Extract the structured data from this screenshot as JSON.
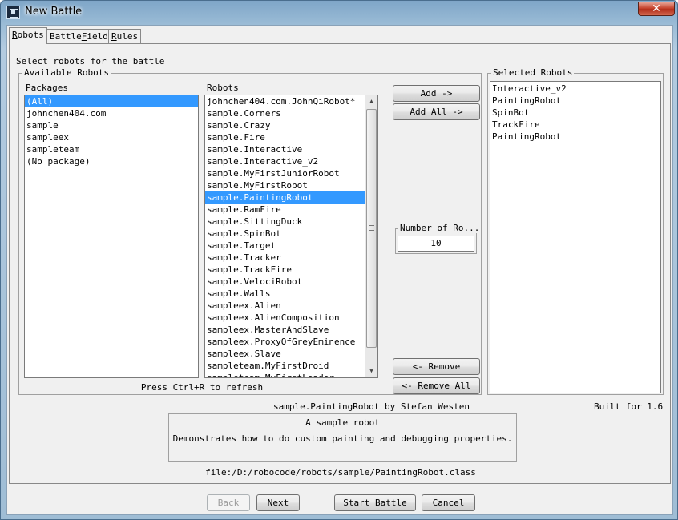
{
  "window": {
    "title": "New Battle",
    "close_label": "✕"
  },
  "tabs": [
    {
      "label": "Robots",
      "mnemonic": "R",
      "rest": "obots"
    },
    {
      "label": "BattleField",
      "pre": "Battle",
      "mnemonic": "F",
      "rest": "ield"
    },
    {
      "label": "Rules",
      "mnemonic": "R",
      "rest": "ules"
    }
  ],
  "robots_tab": {
    "instruction": "Select robots for the battle",
    "available_group": "Available Robots",
    "packages_header": "Packages",
    "robots_header": "Robots",
    "packages": [
      "(All)",
      "johnchen404.com",
      "sample",
      "sampleex",
      "sampleteam",
      "(No package)"
    ],
    "packages_selected": "(All)",
    "robots": [
      "johnchen404.com.JohnQiRobot*",
      "sample.Corners",
      "sample.Crazy",
      "sample.Fire",
      "sample.Interactive",
      "sample.Interactive_v2",
      "sample.MyFirstJuniorRobot",
      "sample.MyFirstRobot",
      "sample.PaintingRobot",
      "sample.RamFire",
      "sample.SittingDuck",
      "sample.SpinBot",
      "sample.Target",
      "sample.Tracker",
      "sample.TrackFire",
      "sample.VelociRobot",
      "sample.Walls",
      "sampleex.Alien",
      "sampleex.AlienComposition",
      "sampleex.MasterAndSlave",
      "sampleex.ProxyOfGreyEminence",
      "sampleex.Slave",
      "sampleteam.MyFirstDroid",
      "sampleteam.MyFirstLeader"
    ],
    "robots_selected": "sample.PaintingRobot",
    "refresh_hint": "Press Ctrl+R to refresh",
    "add_button": "Add ->",
    "add_all_button": "Add All ->",
    "number_of_rounds_label": "Number of Ro...",
    "number_of_rounds_value": "10",
    "remove_button": "<- Remove",
    "remove_all_button": "<- Remove All",
    "selected_group": "Selected Robots",
    "selected_robots": [
      "Interactive_v2",
      "PaintingRobot",
      "SpinBot",
      "TrackFire",
      "PaintingRobot"
    ]
  },
  "robot_info": {
    "name_line": "sample.PaintingRobot by Stefan Westen",
    "built_for": "Built for 1.6",
    "description_line1": "A sample robot",
    "description_line2": "Demonstrates how to do custom painting and debugging properties.",
    "file_path": "file:/D:/robocode/robots/sample/PaintingRobot.class"
  },
  "footer": {
    "back": "Back",
    "next": "Next",
    "start_battle": "Start Battle",
    "cancel": "Cancel"
  }
}
